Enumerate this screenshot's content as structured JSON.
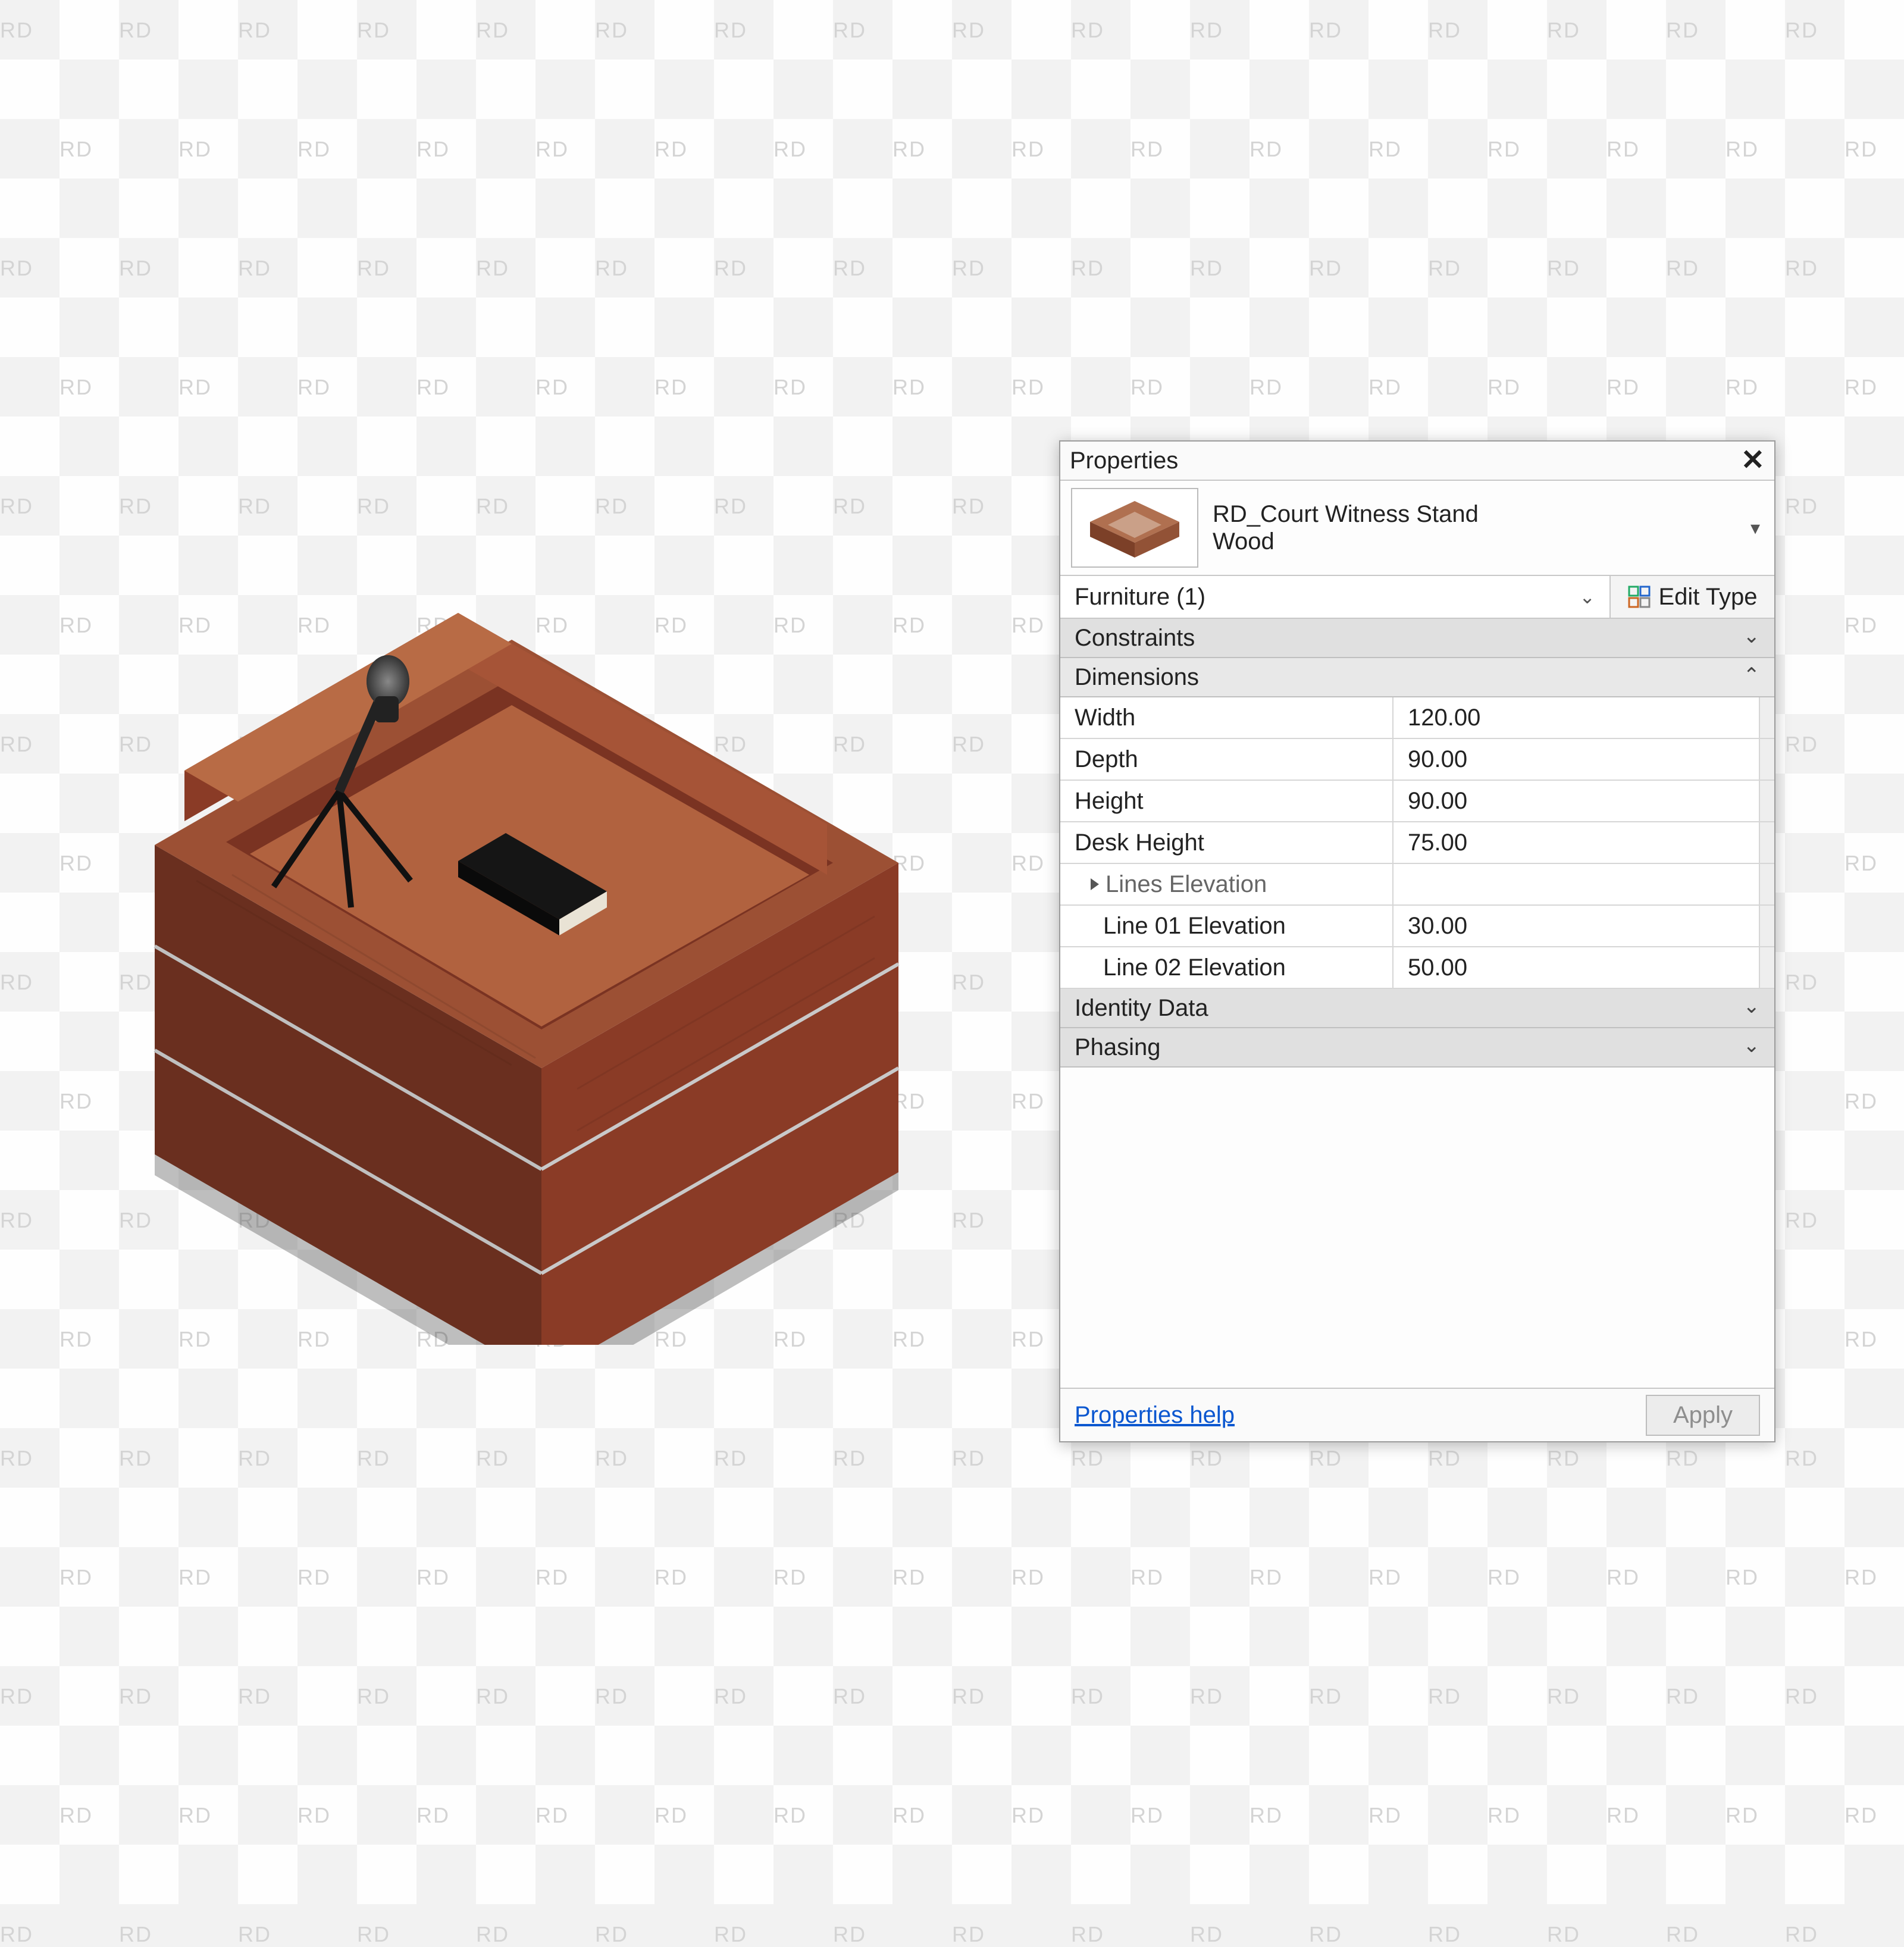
{
  "watermark": "RD",
  "panel": {
    "title": "Properties",
    "type": {
      "line1": "RD_Court Witness Stand",
      "line2": "Wood"
    },
    "selector": "Furniture (1)",
    "edit_type": "Edit Type",
    "categories": {
      "constraints": "Constraints",
      "dimensions": "Dimensions",
      "identity": "Identity Data",
      "phasing": "Phasing"
    },
    "props": {
      "width": {
        "label": "Width",
        "value": "120.00"
      },
      "depth": {
        "label": "Depth",
        "value": "90.00"
      },
      "height": {
        "label": "Height",
        "value": "90.00"
      },
      "desk_height": {
        "label": "Desk Height",
        "value": "75.00"
      },
      "lines_elev": {
        "label": "Lines Elevation",
        "value": ""
      },
      "line01": {
        "label": "Line 01 Elevation",
        "value": "30.00"
      },
      "line02": {
        "label": "Line 02 Elevation",
        "value": "50.00"
      }
    },
    "help": "Properties help",
    "apply": "Apply"
  },
  "colors": {
    "wood_dark": "#5c261a",
    "wood_mid": "#8a3b26",
    "wood_light": "#a65437",
    "wood_top": "#9c5034",
    "steel": "#777",
    "black": "#1a1a1a"
  }
}
